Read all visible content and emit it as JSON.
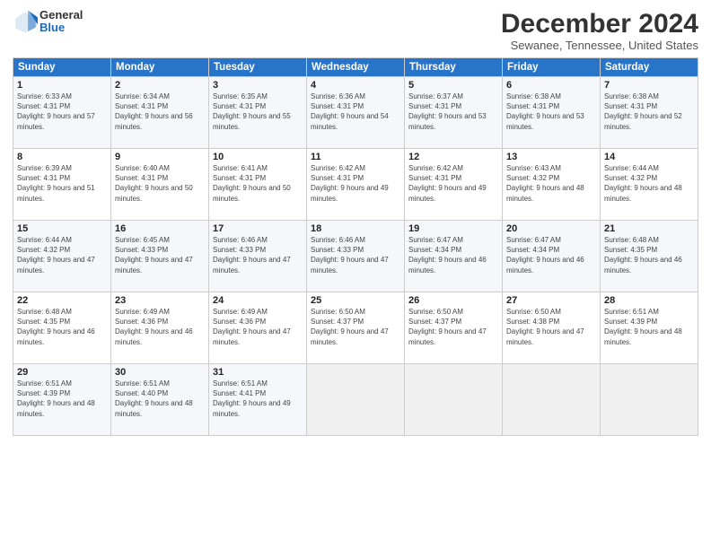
{
  "logo": {
    "general": "General",
    "blue": "Blue"
  },
  "title": "December 2024",
  "subtitle": "Sewanee, Tennessee, United States",
  "weekdays": [
    "Sunday",
    "Monday",
    "Tuesday",
    "Wednesday",
    "Thursday",
    "Friday",
    "Saturday"
  ],
  "weeks": [
    [
      {
        "day": "1",
        "sunrise": "Sunrise: 6:33 AM",
        "sunset": "Sunset: 4:31 PM",
        "daylight": "Daylight: 9 hours and 57 minutes."
      },
      {
        "day": "2",
        "sunrise": "Sunrise: 6:34 AM",
        "sunset": "Sunset: 4:31 PM",
        "daylight": "Daylight: 9 hours and 56 minutes."
      },
      {
        "day": "3",
        "sunrise": "Sunrise: 6:35 AM",
        "sunset": "Sunset: 4:31 PM",
        "daylight": "Daylight: 9 hours and 55 minutes."
      },
      {
        "day": "4",
        "sunrise": "Sunrise: 6:36 AM",
        "sunset": "Sunset: 4:31 PM",
        "daylight": "Daylight: 9 hours and 54 minutes."
      },
      {
        "day": "5",
        "sunrise": "Sunrise: 6:37 AM",
        "sunset": "Sunset: 4:31 PM",
        "daylight": "Daylight: 9 hours and 53 minutes."
      },
      {
        "day": "6",
        "sunrise": "Sunrise: 6:38 AM",
        "sunset": "Sunset: 4:31 PM",
        "daylight": "Daylight: 9 hours and 53 minutes."
      },
      {
        "day": "7",
        "sunrise": "Sunrise: 6:38 AM",
        "sunset": "Sunset: 4:31 PM",
        "daylight": "Daylight: 9 hours and 52 minutes."
      }
    ],
    [
      {
        "day": "8",
        "sunrise": "Sunrise: 6:39 AM",
        "sunset": "Sunset: 4:31 PM",
        "daylight": "Daylight: 9 hours and 51 minutes."
      },
      {
        "day": "9",
        "sunrise": "Sunrise: 6:40 AM",
        "sunset": "Sunset: 4:31 PM",
        "daylight": "Daylight: 9 hours and 50 minutes."
      },
      {
        "day": "10",
        "sunrise": "Sunrise: 6:41 AM",
        "sunset": "Sunset: 4:31 PM",
        "daylight": "Daylight: 9 hours and 50 minutes."
      },
      {
        "day": "11",
        "sunrise": "Sunrise: 6:42 AM",
        "sunset": "Sunset: 4:31 PM",
        "daylight": "Daylight: 9 hours and 49 minutes."
      },
      {
        "day": "12",
        "sunrise": "Sunrise: 6:42 AM",
        "sunset": "Sunset: 4:31 PM",
        "daylight": "Daylight: 9 hours and 49 minutes."
      },
      {
        "day": "13",
        "sunrise": "Sunrise: 6:43 AM",
        "sunset": "Sunset: 4:32 PM",
        "daylight": "Daylight: 9 hours and 48 minutes."
      },
      {
        "day": "14",
        "sunrise": "Sunrise: 6:44 AM",
        "sunset": "Sunset: 4:32 PM",
        "daylight": "Daylight: 9 hours and 48 minutes."
      }
    ],
    [
      {
        "day": "15",
        "sunrise": "Sunrise: 6:44 AM",
        "sunset": "Sunset: 4:32 PM",
        "daylight": "Daylight: 9 hours and 47 minutes."
      },
      {
        "day": "16",
        "sunrise": "Sunrise: 6:45 AM",
        "sunset": "Sunset: 4:33 PM",
        "daylight": "Daylight: 9 hours and 47 minutes."
      },
      {
        "day": "17",
        "sunrise": "Sunrise: 6:46 AM",
        "sunset": "Sunset: 4:33 PM",
        "daylight": "Daylight: 9 hours and 47 minutes."
      },
      {
        "day": "18",
        "sunrise": "Sunrise: 6:46 AM",
        "sunset": "Sunset: 4:33 PM",
        "daylight": "Daylight: 9 hours and 47 minutes."
      },
      {
        "day": "19",
        "sunrise": "Sunrise: 6:47 AM",
        "sunset": "Sunset: 4:34 PM",
        "daylight": "Daylight: 9 hours and 46 minutes."
      },
      {
        "day": "20",
        "sunrise": "Sunrise: 6:47 AM",
        "sunset": "Sunset: 4:34 PM",
        "daylight": "Daylight: 9 hours and 46 minutes."
      },
      {
        "day": "21",
        "sunrise": "Sunrise: 6:48 AM",
        "sunset": "Sunset: 4:35 PM",
        "daylight": "Daylight: 9 hours and 46 minutes."
      }
    ],
    [
      {
        "day": "22",
        "sunrise": "Sunrise: 6:48 AM",
        "sunset": "Sunset: 4:35 PM",
        "daylight": "Daylight: 9 hours and 46 minutes."
      },
      {
        "day": "23",
        "sunrise": "Sunrise: 6:49 AM",
        "sunset": "Sunset: 4:36 PM",
        "daylight": "Daylight: 9 hours and 46 minutes."
      },
      {
        "day": "24",
        "sunrise": "Sunrise: 6:49 AM",
        "sunset": "Sunset: 4:36 PM",
        "daylight": "Daylight: 9 hours and 47 minutes."
      },
      {
        "day": "25",
        "sunrise": "Sunrise: 6:50 AM",
        "sunset": "Sunset: 4:37 PM",
        "daylight": "Daylight: 9 hours and 47 minutes."
      },
      {
        "day": "26",
        "sunrise": "Sunrise: 6:50 AM",
        "sunset": "Sunset: 4:37 PM",
        "daylight": "Daylight: 9 hours and 47 minutes."
      },
      {
        "day": "27",
        "sunrise": "Sunrise: 6:50 AM",
        "sunset": "Sunset: 4:38 PM",
        "daylight": "Daylight: 9 hours and 47 minutes."
      },
      {
        "day": "28",
        "sunrise": "Sunrise: 6:51 AM",
        "sunset": "Sunset: 4:39 PM",
        "daylight": "Daylight: 9 hours and 48 minutes."
      }
    ],
    [
      {
        "day": "29",
        "sunrise": "Sunrise: 6:51 AM",
        "sunset": "Sunset: 4:39 PM",
        "daylight": "Daylight: 9 hours and 48 minutes."
      },
      {
        "day": "30",
        "sunrise": "Sunrise: 6:51 AM",
        "sunset": "Sunset: 4:40 PM",
        "daylight": "Daylight: 9 hours and 48 minutes."
      },
      {
        "day": "31",
        "sunrise": "Sunrise: 6:51 AM",
        "sunset": "Sunset: 4:41 PM",
        "daylight": "Daylight: 9 hours and 49 minutes."
      },
      null,
      null,
      null,
      null
    ]
  ]
}
